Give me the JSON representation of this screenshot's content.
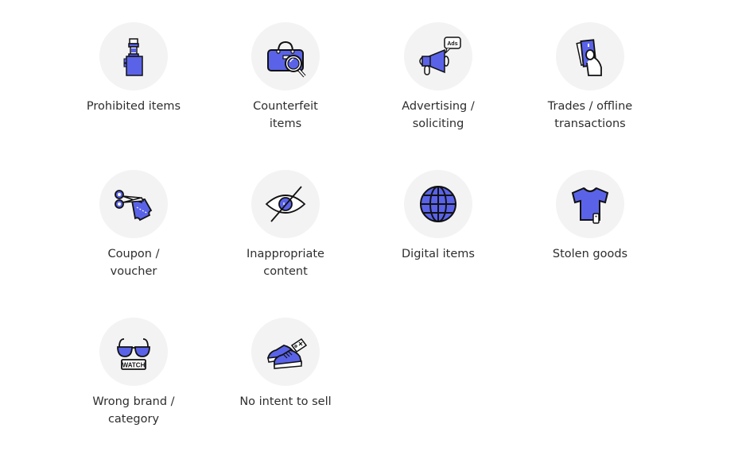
{
  "accent_color": "#5a63e8",
  "outline_color": "#111111",
  "circle_color": "#f3f3f3",
  "categories": [
    {
      "label": "Prohibited items",
      "icon": "vape-icon"
    },
    {
      "label": "Counterfeit\nitems",
      "icon": "bag-magnifier-icon"
    },
    {
      "label": "Advertising /\nsoliciting",
      "icon": "megaphone-ads-icon",
      "icon_text": "Ads"
    },
    {
      "label": "Trades / offline\ntransactions",
      "icon": "cash-hand-icon"
    },
    {
      "label": "Coupon /\nvoucher",
      "icon": "scissors-coupon-icon"
    },
    {
      "label": "Inappropriate\ncontent",
      "icon": "eye-slash-icon"
    },
    {
      "label": "Digital items",
      "icon": "globe-icon"
    },
    {
      "label": "Stolen goods",
      "icon": "tshirt-tag-icon"
    },
    {
      "label": "Wrong brand /\ncategory",
      "icon": "glasses-watch-icon",
      "icon_text": "WATCH"
    },
    {
      "label": "No intent to sell",
      "icon": "sneakers-tag-icon"
    }
  ]
}
